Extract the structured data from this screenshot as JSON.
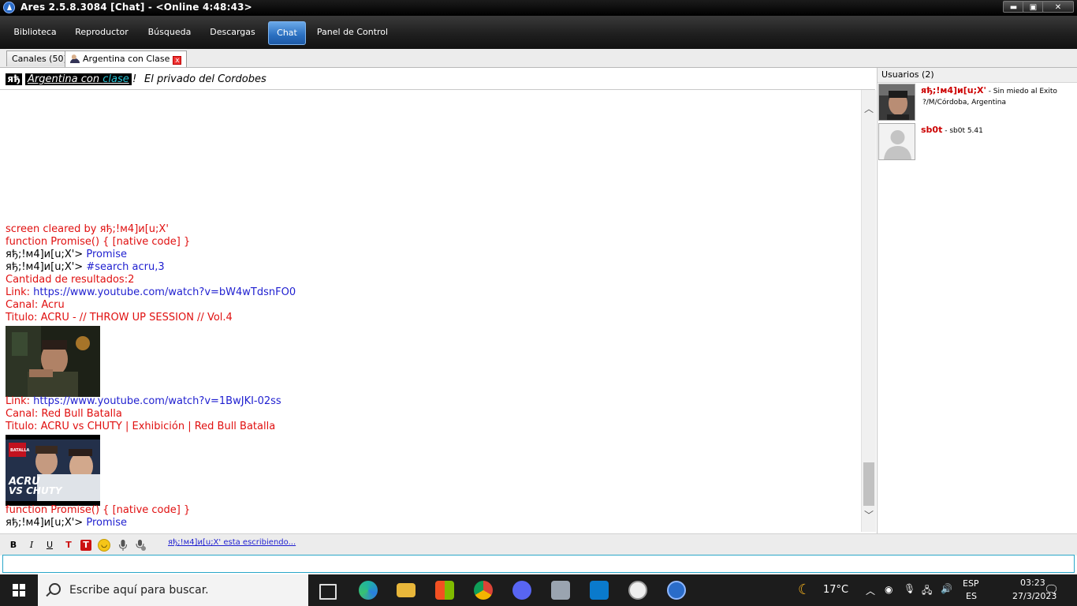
{
  "window": {
    "title": "Ares 2.5.8.3084  [Chat]  - <Online 4:48:43>",
    "controls": [
      "▬",
      "▣",
      "✕"
    ]
  },
  "menu": {
    "items": [
      "Biblioteca",
      "Reproductor",
      "Búsqueda",
      "Descargas",
      "Chat",
      "Panel de Control"
    ],
    "active": "Chat"
  },
  "tabs": {
    "channels": "Canales (50)",
    "room": "Argentina con Clase",
    "close": "x"
  },
  "topic": {
    "prefix": "яђ",
    "name_part1": "Argentina con ",
    "name_part2": "clase",
    "bang": "!",
    "subtitle": "El privado del Cordobes"
  },
  "chat": {
    "lines": [
      {
        "text": "screen cleared by яђ;!м4]и[u;X'"
      },
      {
        "text": "function Promise() { [native code] }"
      },
      {
        "user": "яђ;!м4]и[u;X'>",
        "msg": "Promise"
      },
      {
        "user": "яђ;!м4]и[u;X'>",
        "msg": "#search acru,3"
      },
      {
        "text": "Cantidad de resultados:2"
      },
      {
        "label": "Link:",
        "link": "https://www.youtube.com/watch?v=bW4wTdsnFO0"
      },
      {
        "text": "Canal: Acru"
      },
      {
        "text": "Titulo: ACRU - // THROW UP SESSION // Vol.4"
      },
      {
        "label": "Link:",
        "link": "https://www.youtube.com/watch?v=1BwJKI-02ss"
      },
      {
        "text": "Canal: Red Bull Batalla"
      },
      {
        "text": "Titulo: ACRU vs CHUTY | Exhibición | Red Bull Batalla"
      },
      {
        "text": "function Promise() { [native code] }"
      },
      {
        "user": "яђ;!м4]и[u;X'>",
        "msg": "Promise"
      }
    ],
    "thumb2_text": [
      "ACRU",
      "VS CHUTY"
    ],
    "thumb2_badge": "BATALLA"
  },
  "users": {
    "header": "Usuarios (2)",
    "list": [
      {
        "name": "яђ;!м4]и[u;X'",
        "status": " - Sin miedo al Exito",
        "location": "?/M/Córdoba, Argentina"
      },
      {
        "name": "sb0t",
        "status": " - sb0t 5.41",
        "location": ""
      }
    ]
  },
  "toolbar": {
    "typing": "яђ;!м4]и[u;X' esta escribiendo..."
  },
  "taskbar": {
    "search_placeholder": "Escribe aquí para buscar.",
    "weather": "17°C",
    "lang1": "ESP",
    "lang2": "ES",
    "time": "03:23",
    "date": "27/3/2023"
  },
  "colors": {
    "chat_red": "#e01010",
    "link_blue": "#1f1fd0",
    "active_tab_blue": "#2a6fc0"
  }
}
